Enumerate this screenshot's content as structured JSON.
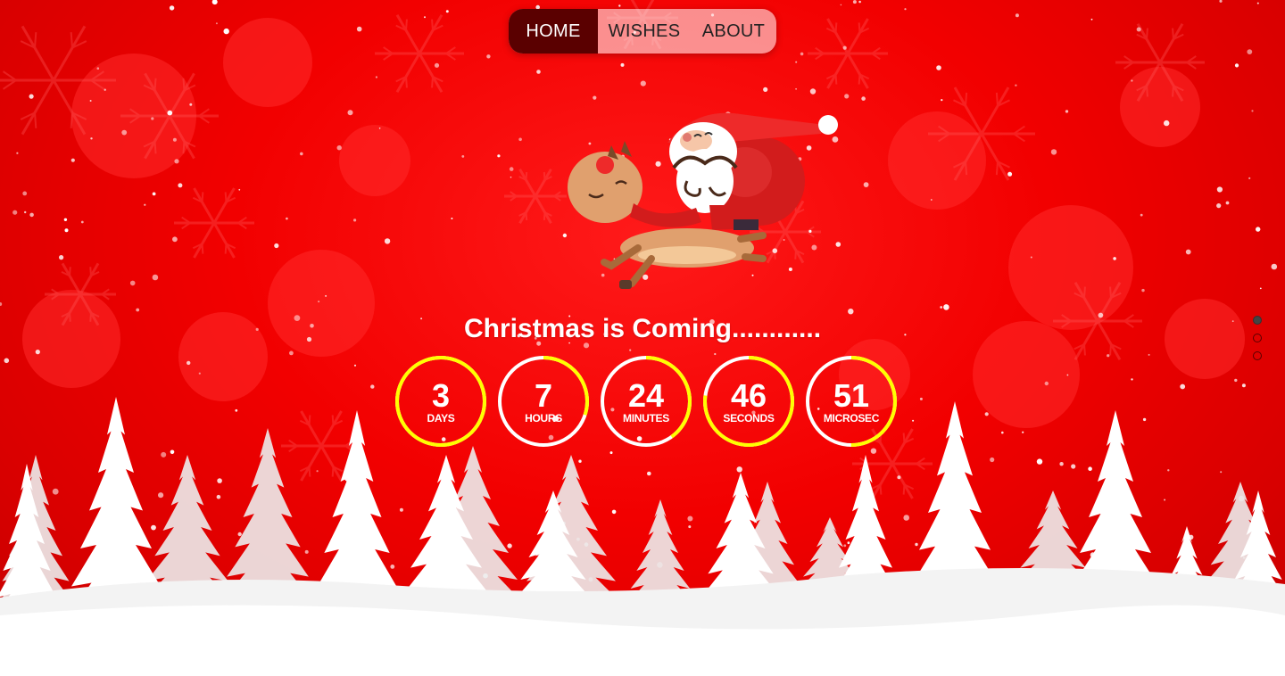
{
  "nav": {
    "items": [
      {
        "label": "HOME",
        "active": true
      },
      {
        "label": "WISHES",
        "active": false
      },
      {
        "label": "ABOUT",
        "active": false
      }
    ]
  },
  "headline": "Christmas is Coming............",
  "countdown": [
    {
      "value": "3",
      "unit": "DAYS",
      "progress": 1.0
    },
    {
      "value": "7",
      "unit": "HOURS",
      "progress": 0.3
    },
    {
      "value": "24",
      "unit": "MINUTES",
      "progress": 0.4
    },
    {
      "value": "46",
      "unit": "SECONDS",
      "progress": 0.77
    },
    {
      "value": "51",
      "unit": "MICROSEC",
      "progress": 0.5
    }
  ],
  "colors": {
    "accent_ring": "#ffff00",
    "ring_track": "#ffffff",
    "nav_active_bg": "#5a0000",
    "background": "#f20000"
  },
  "slider_dots": {
    "count": 3,
    "active_index": 0
  },
  "icons": [
    "santa-reindeer-illustration",
    "snowflake-pattern",
    "pine-forest-silhouette"
  ]
}
